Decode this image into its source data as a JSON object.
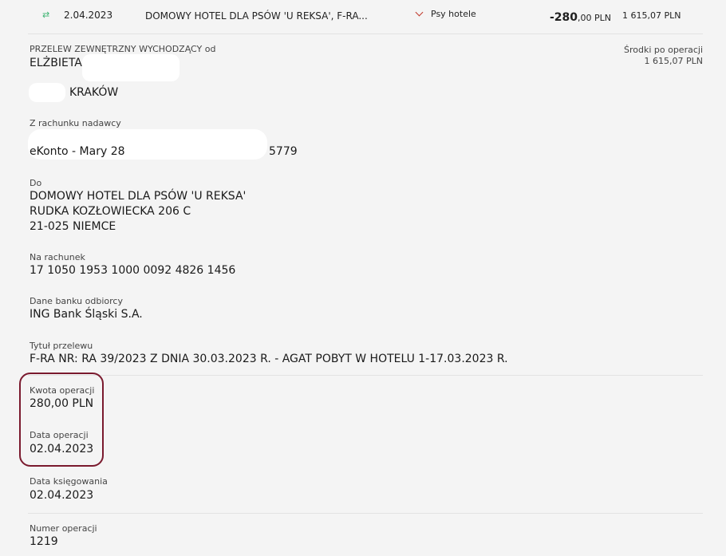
{
  "transaction_row": {
    "icon": "transfer-icon",
    "date": "2.04.2023",
    "description": "DOMOWY HOTEL DLA PSÓW 'U REKSA', F-RA...",
    "category_icon": "chevron-down-icon",
    "category": "Psy hotele",
    "amount_main": "-280",
    "amount_decimals": ",00 PLN",
    "balance": "1 615,07 PLN",
    "category_color": "#c0392b",
    "icon_color": "#3cb371"
  },
  "details": {
    "type_label": "PRZELEW ZEWNĘTRZNY WYCHODZĄCY od",
    "sender_name": "ELŻBIETA",
    "sender_city": "KRAKÓW",
    "funds_after_label": "Środki po operacji",
    "funds_after_value": "1 615,07 PLN",
    "from_account_label": "Z rachunku nadawcy",
    "from_account_name": "eKonto - Mary 28",
    "from_account_suffix": "5779",
    "to_label": "Do",
    "to_name": "DOMOWY HOTEL DLA PSÓW 'U REKSA'",
    "to_street": "RUDKA KOZŁOWIECKA 206 C",
    "to_city": "21-025 NIEMCE",
    "to_account_label": "Na rachunek",
    "to_account_value": "17 1050 1953 1000 0092 4826 1456",
    "bank_label": "Dane banku odbiorcy",
    "bank_value": "ING Bank Śląski S.A.",
    "title_label": "Tytuł przelewu",
    "title_value": "F-RA NR: RA 39/2023 Z DNIA 30.03.2023 R. - AGAT POBYT W HOTELU 1-17.03.2023 R.",
    "amount_label": "Kwota operacji",
    "amount_value": "280,00 PLN",
    "op_date_label": "Data operacji",
    "op_date_value": "02.04.2023",
    "booking_date_label": "Data księgowania",
    "booking_date_value": "02.04.2023",
    "op_number_label": "Numer operacji",
    "op_number_value": "1219",
    "highlight_color": "#7a1a2e"
  }
}
